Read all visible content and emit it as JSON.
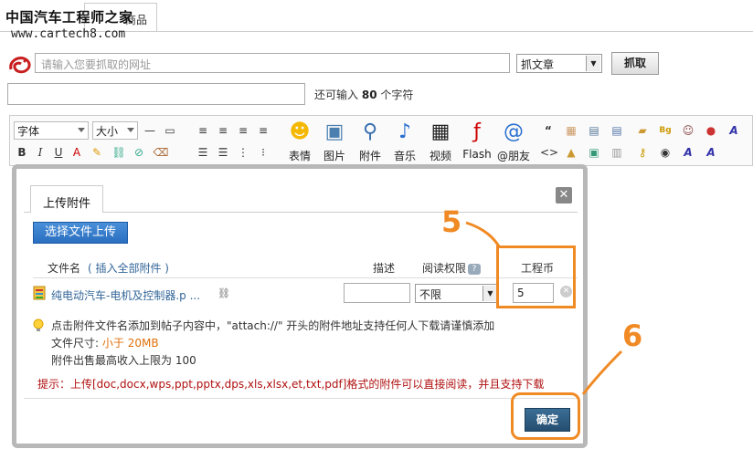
{
  "watermark": {
    "logo_text": "中国汽车工程师之家",
    "url": "www.cartech8.com"
  },
  "top_tab": {
    "label": "商品"
  },
  "grab": {
    "url_placeholder": "请输入您要抓取的网址",
    "mode_selected": "抓文章",
    "button_label": "抓取"
  },
  "title_hint": {
    "prefix": "还可输入",
    "count": "80",
    "suffix": "个字符"
  },
  "toolbar": {
    "font_label": "字体",
    "size_label": "大小",
    "big_buttons": [
      "表情",
      "图片",
      "附件",
      "音乐",
      "视频",
      "Flash",
      "@朋友"
    ]
  },
  "dialog": {
    "tab_label": "上传附件",
    "choose_button": "选择文件上传",
    "header": {
      "filename": "文件名",
      "insert_all": "( 插入全部附件 )",
      "description": "描述",
      "permission": "阅读权限",
      "coin": "工程币"
    },
    "file": {
      "name": "纯电动汽车-电机及控制器.p ...",
      "permission": "不限",
      "coin": "5"
    },
    "tips": {
      "line1": "点击附件文件名添加到帖子内容中，\"attach://\" 开头的附件地址支持任何人下载请谨慎添加",
      "size_label": "文件尺寸:",
      "size_value": "小于 20MB",
      "limit": "附件出售最高收入上限为 100"
    },
    "notice": "提示：上传[doc,docx,wps,ppt,pptx,dps,xls,xlsx,et,txt,pdf]格式的附件可以直接阅读，并且支持下载",
    "confirm_button": "确定"
  },
  "annotations": {
    "step1": "5",
    "step2": "6",
    "color": "#f08a24"
  }
}
